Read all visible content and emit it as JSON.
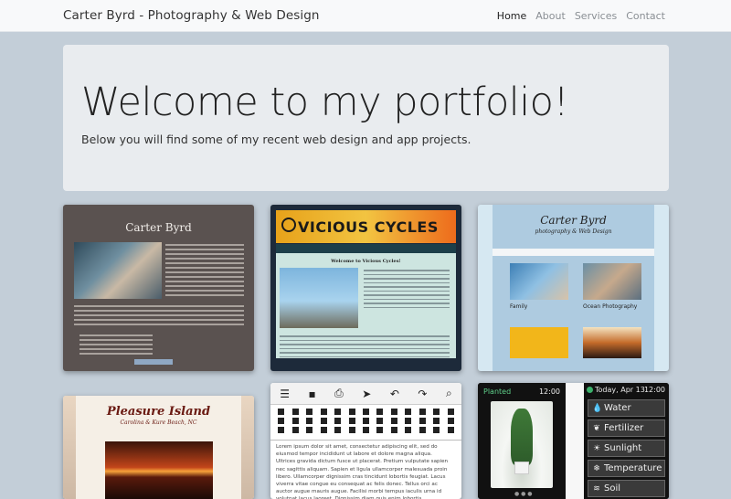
{
  "navbar": {
    "brand": "Carter Byrd - Photography & Web Design",
    "links": [
      {
        "label": "Home",
        "active": true
      },
      {
        "label": "About",
        "active": false
      },
      {
        "label": "Services",
        "active": false
      },
      {
        "label": "Contact",
        "active": false
      }
    ]
  },
  "jumbotron": {
    "heading": "Welcome to my portfolio!",
    "lead": "Below you will find some of my recent web design and app projects."
  },
  "projects": {
    "card1": {
      "title": "Carter Byrd"
    },
    "card2": {
      "brand": "VICIOUS CYCLES",
      "heading": "Welcome to Vicious Cycles!"
    },
    "card3": {
      "title": "Carter Byrd",
      "subtitle": "photography & Web Design",
      "thumb1": "Family",
      "thumb2": "Ocean Photography"
    },
    "card4": {
      "title": "Pleasure Island",
      "subtitle": "Carolina & Kure Beach, NC"
    },
    "card5": {
      "body": "Lorem ipsum dolor sit amet, consectetur adipiscing elit, sed do eiusmod tempor incididunt ut labore et dolore magna aliqua. Ultrices gravida dictum fusce ut placerat. Pretium vulputate sapien nec sagittis aliquam. Sapien et ligula ullamcorper malesuada proin libero. Ullamcorper dignissim cras tincidunt lobortis feugiat. Lacus viverra vitae congue eu consequat ac felis donec. Tellus orci ac auctor augue mauris augue. Facilisi morbi tempus iaculis urna id volutpat lacus laoreet. Dignissim diam quis enim lobortis scelerisque fermentum dui faucibus. Augue neque gravida in fermentum et. Nec sagittis aliquam"
    },
    "card6": {
      "screen1_header": "Planted",
      "screen1_time": "12:00",
      "screen2_date": "Today, Apr 13",
      "screen2_time": "12:00",
      "items": [
        {
          "label": "Water",
          "icon": "drop-icon"
        },
        {
          "label": "Fertilizer",
          "icon": "sprout-icon"
        },
        {
          "label": "Sunlight",
          "icon": "sun-icon"
        },
        {
          "label": "Temperature",
          "icon": "snowflake-icon"
        },
        {
          "label": "Soil",
          "icon": "soil-icon"
        }
      ]
    }
  }
}
